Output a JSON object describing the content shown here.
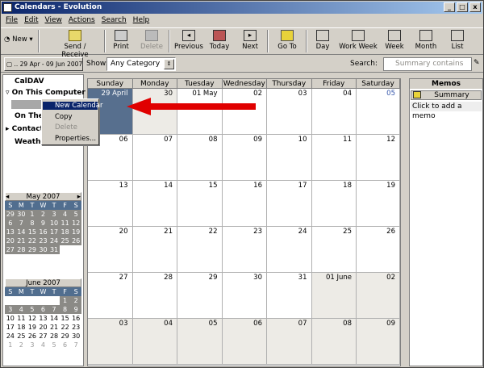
{
  "window": {
    "title": "Calendars - Evolution",
    "btn_min": "_",
    "btn_max": "□",
    "btn_close": "x"
  },
  "menu": [
    "File",
    "Edit",
    "View",
    "Actions",
    "Search",
    "Help"
  ],
  "toolbar": {
    "new": "New",
    "send_receive": "Send / Receive",
    "print": "Print",
    "delete": "Delete",
    "previous": "Previous",
    "today": "Today",
    "next": "Next",
    "goto": "Go To",
    "day": "Day",
    "work_week": "Work Week",
    "week": "Week",
    "month": "Month",
    "list": "List"
  },
  "row2": {
    "date_range": ".. 29 Apr - 09 Jun 2007",
    "show_label": "Show:",
    "category": "Any Category",
    "search_label": "Search:",
    "search_placeholder": "Summary contains"
  },
  "tree": {
    "caldav": "CalDAV",
    "on_this_computer": "On This Computer",
    "on_the_web": "On The W",
    "contacts": "Contacts",
    "weather": "Weather"
  },
  "context_menu": {
    "new_calendar": "New Calendar",
    "copy": "Copy",
    "delete": "Delete",
    "properties": "Properties..."
  },
  "minical_may": {
    "title": "May 2007",
    "days": [
      "S",
      "M",
      "T",
      "W",
      "T",
      "F",
      "S"
    ],
    "rows": [
      [
        "29",
        "30",
        "1",
        "2",
        "3",
        "4",
        "5"
      ],
      [
        "6",
        "7",
        "8",
        "9",
        "10",
        "11",
        "12"
      ],
      [
        "13",
        "14",
        "15",
        "16",
        "17",
        "18",
        "19"
      ],
      [
        "20",
        "21",
        "22",
        "23",
        "24",
        "25",
        "26"
      ],
      [
        "27",
        "28",
        "29",
        "30",
        "31",
        "",
        ""
      ]
    ]
  },
  "minical_june": {
    "title": "June 2007",
    "days": [
      "S",
      "M",
      "T",
      "W",
      "T",
      "F",
      "S"
    ],
    "rows": [
      [
        "",
        "",
        "",
        "",
        "",
        "1",
        "2"
      ],
      [
        "3",
        "4",
        "5",
        "6",
        "7",
        "8",
        "9"
      ],
      [
        "10",
        "11",
        "12",
        "13",
        "14",
        "15",
        "16"
      ],
      [
        "17",
        "18",
        "19",
        "20",
        "21",
        "22",
        "23"
      ],
      [
        "24",
        "25",
        "26",
        "27",
        "28",
        "29",
        "30"
      ],
      [
        "1",
        "2",
        "3",
        "4",
        "5",
        "6",
        "7"
      ]
    ]
  },
  "cal": {
    "days": [
      "Sunday",
      "Monday",
      "Tuesday",
      "Wednesday",
      "Thursday",
      "Friday",
      "Saturday"
    ],
    "weeks": [
      [
        "29 April",
        "30",
        "01 May",
        "02",
        "03",
        "04",
        "05"
      ],
      [
        "06",
        "07",
        "08",
        "09",
        "10",
        "11",
        "12"
      ],
      [
        "13",
        "14",
        "15",
        "16",
        "17",
        "18",
        "19"
      ],
      [
        "20",
        "21",
        "22",
        "23",
        "24",
        "25",
        "26"
      ],
      [
        "27",
        "28",
        "29",
        "30",
        "31",
        "01 June",
        "02"
      ],
      [
        "03",
        "04",
        "05",
        "06",
        "07",
        "08",
        "09"
      ]
    ]
  },
  "memos": {
    "title": "Memos",
    "summary": "Summary",
    "add": "Click to add a memo"
  }
}
